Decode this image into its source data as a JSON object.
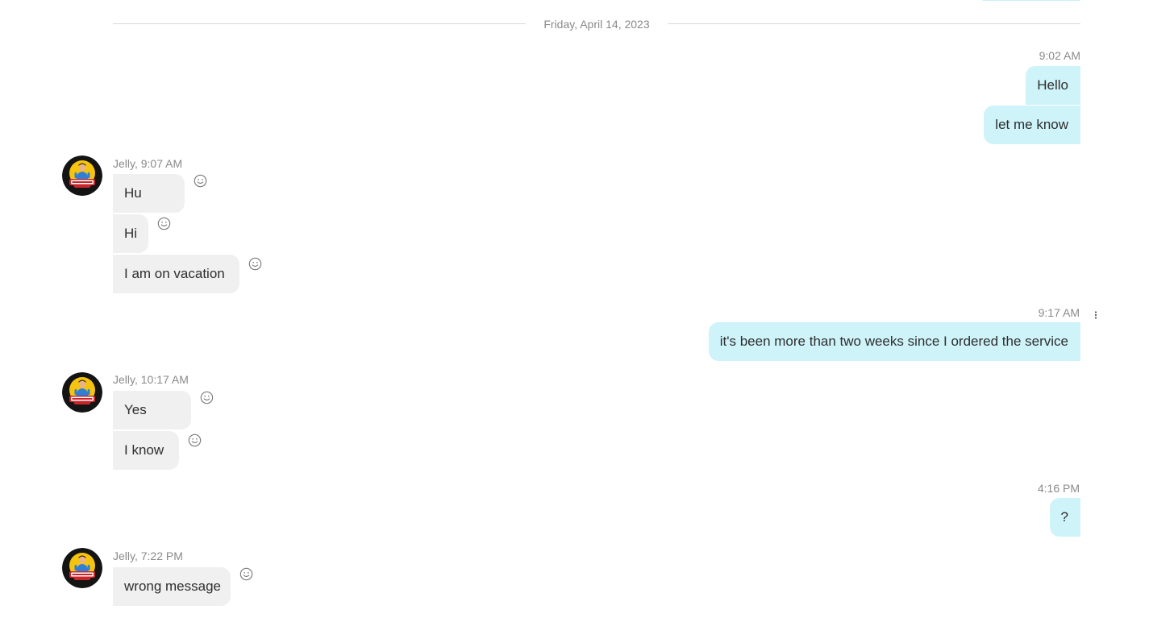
{
  "conversation": {
    "date_divider": "Friday, April 14, 2023",
    "contact_name": "Jelly",
    "groups": [
      {
        "direction": "out",
        "time": "9:02 AM",
        "messages": [
          "Hello",
          "let me know"
        ]
      },
      {
        "direction": "in",
        "header": "Jelly, 9:07 AM",
        "messages": [
          "Hu",
          "Hi",
          "I am on vacation"
        ]
      },
      {
        "direction": "out",
        "time": "9:17 AM",
        "messages": [
          "it's been more than two weeks since I ordered the service"
        ]
      },
      {
        "direction": "in",
        "header": "Jelly, 10:17 AM",
        "messages": [
          "Yes",
          "I know"
        ]
      },
      {
        "direction": "out",
        "time": "4:16 PM",
        "messages": [
          "?"
        ]
      },
      {
        "direction": "in",
        "header": "Jelly, 7:22 PM",
        "messages": [
          "wrong message"
        ]
      }
    ]
  },
  "icons": {
    "reaction": "smiley-icon",
    "more_options": "more-vertical-icon",
    "avatar": "avatar-jelly-bean-logo"
  },
  "colors": {
    "outgoing_bubble": "#cef3f9",
    "incoming_bubble": "#f0f0f0",
    "timestamp_text": "#8a8a8a",
    "message_text": "#2e2e2e",
    "divider_line": "#d9d9d9"
  }
}
